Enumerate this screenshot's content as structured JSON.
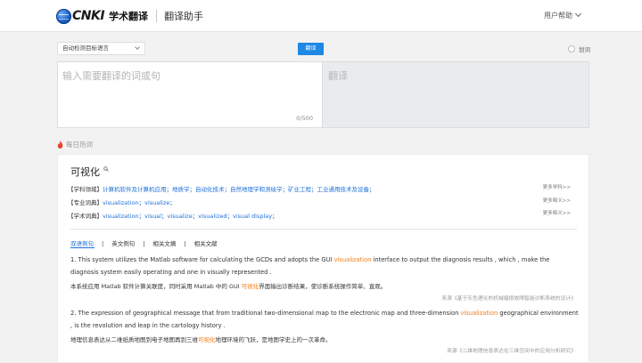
{
  "header": {
    "logo_text": "CNKI",
    "logo_cn": "学术翻译",
    "subtitle": "翻译助手",
    "user_help": "用户帮助"
  },
  "toolbar": {
    "lang_select": "自动检测目标语言",
    "translate_button": "翻译",
    "scroll_toggle": "划词"
  },
  "input": {
    "placeholder": "输入需要翻译的词或句",
    "counter": "0/500"
  },
  "output": {
    "placeholder": "翻译"
  },
  "hot": {
    "title": "每日热词"
  },
  "entry": {
    "word": "可视化",
    "rows": [
      {
        "label": "【学科领域】",
        "value": "计算机软件及计算机应用；地质学；自动化技术；自然地理学和测绘学；矿业工程；工业通用技术及设备；",
        "more": "更多学科>>"
      },
      {
        "label": "【专业词典】",
        "value": "visualization；visualize；",
        "more": "更多释义>>"
      },
      {
        "label": "【学术词典】",
        "value": "visualization；visual；visualize；visualized；visual display；",
        "more": "更多释义>>"
      }
    ],
    "tabs": [
      "双语例句",
      "英文例句",
      "相关文摘",
      "相关文献"
    ],
    "examples": [
      {
        "en_pre": "1. This system utilizes the Matlab software for calculating the GCDs and adopts the GUI ",
        "en_hl": "visualization",
        "en_post": " interface to output the diagnosis results , which , make the diagnosis system easily operating and one in visually represented .",
        "cn_pre": "本系统应用 Matlab 软件计算关联度，同时采用 Matlab 中的 GUI ",
        "cn_hl": "可视化",
        "cn_post": "界面输出诊断结果，使诊断系统操作简单、直观。",
        "source": "来源《基于灰色理论的机械磨损故障智能诊断系统的设计》"
      },
      {
        "en_pre": "2. The expression of geographical message that from traditional two-dimensional map to the electronic map and three-dimension ",
        "en_hl": "visualization",
        "en_post": " geographical environment , is the revolution and leap in the cartology history .",
        "cn_pre": "地理信息表达从二维纸质地图到电子地图再到三维",
        "cn_hl": "可视化",
        "cn_post": "地理环境的飞跃，是地图学史上的一次革命。",
        "source": "来源《二维地理信息表达在三维空间中的应用分析研究》"
      }
    ]
  },
  "colors": {
    "accent": "#1e88e5",
    "link": "#1e6fd9",
    "highlight": "#f07c1a",
    "fire": "#e8452c"
  }
}
